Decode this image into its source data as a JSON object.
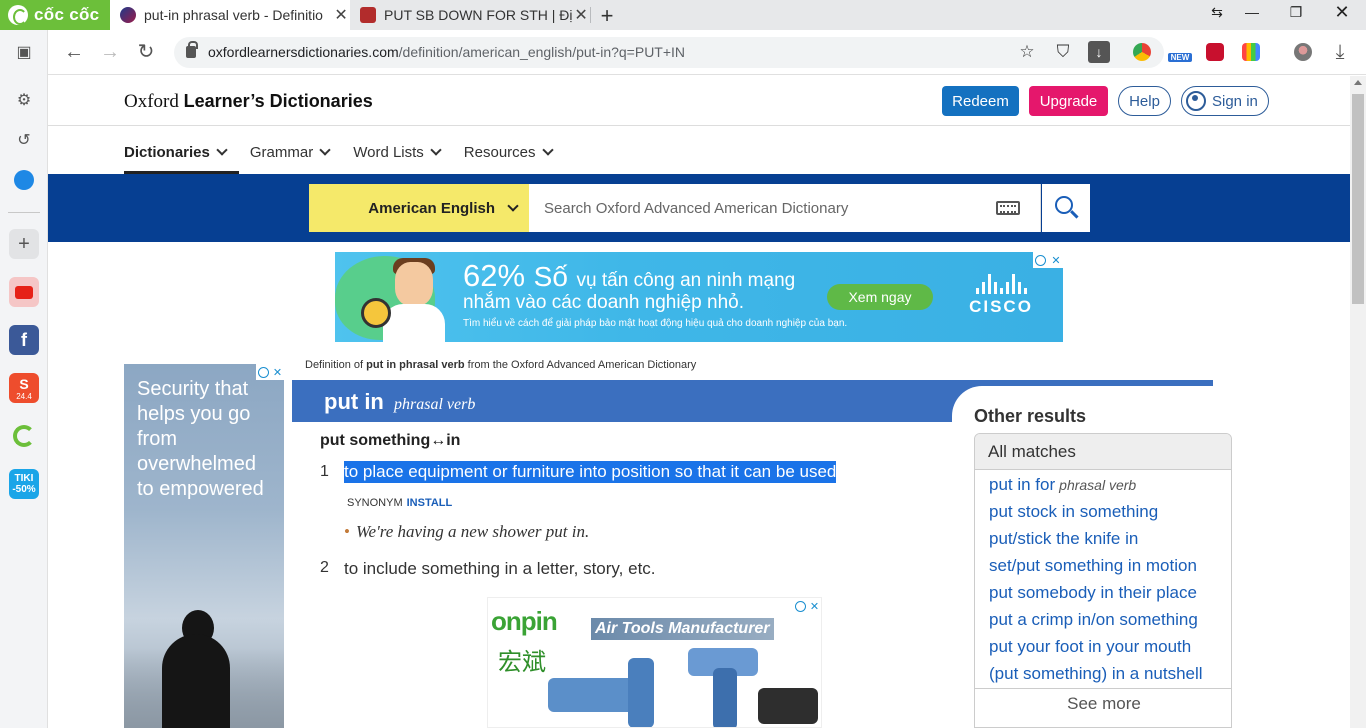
{
  "browser": {
    "brand": "cốc cốc",
    "tabs": [
      {
        "title": "put-in phrasal verb - Definitio",
        "active": true
      },
      {
        "title": "PUT SB DOWN FOR STH | Địn",
        "active": false
      }
    ],
    "url_host": "oxfordlearnersdictionaries.com",
    "url_path": "/definition/american_english/put-in?q=PUT+IN"
  },
  "sidebar": {
    "icons": [
      "panel-icon",
      "settings-icon",
      "history-icon",
      "messenger-icon",
      "add-icon",
      "youtube-icon",
      "facebook-icon",
      "shopee-icon",
      "coccoc-green-icon",
      "tiki-icon"
    ],
    "tiki_label": "TIKI -50%",
    "shopee_label": "24.4"
  },
  "header": {
    "logo_prefix": "Oxford",
    "logo_bold": "Learner’s Dictionaries",
    "redeem": "Redeem",
    "upgrade": "Upgrade",
    "help": "Help",
    "signin": "Sign in"
  },
  "nav": {
    "items": [
      "Dictionaries",
      "Grammar",
      "Word Lists",
      "Resources"
    ]
  },
  "search": {
    "dictionary": "American English",
    "placeholder": "Search Oxford Advanced American Dictionary"
  },
  "ad_top": {
    "big_pct": "62%",
    "big_word": "Số",
    "line1_rest": "vụ tấn công an ninh mạng",
    "line2": "nhắm vào các doanh nghiệp nhỏ.",
    "line3": "Tìm hiểu về cách để giải pháp bảo mật hoạt động hiệu quả cho doanh nghiệp của bạn.",
    "cta": "Xem ngay",
    "brand": "CISCO"
  },
  "ad_left": {
    "text": "Security that helps you go from overwhelmed to empowered"
  },
  "entry": {
    "note_prefix": "Definition of",
    "note_term": "put in phrasal verb",
    "note_suffix": "from the Oxford Advanced American Dictionary",
    "headword": "put in",
    "pos": "phrasal verb",
    "pattern": "put something↔in",
    "senses": [
      {
        "num": "1",
        "def": "to place equipment or furniture into position so that it can be used",
        "synonym_label": "SYNONYM",
        "synonym": "INSTALL",
        "example": "We're having a new shower put in."
      },
      {
        "num": "2",
        "def": "to include something in a letter, story, etc."
      }
    ]
  },
  "ad_mid": {
    "brand": "onpin",
    "cn": "宏斌",
    "tagline": "Air Tools Manufacturer"
  },
  "other_results": {
    "title": "Other results",
    "tab": "All matches",
    "items": [
      {
        "text": "put in for",
        "pos": "phrasal verb"
      },
      {
        "text": "put stock in something",
        "pos": ""
      },
      {
        "text": "put/stick the knife in",
        "pos": ""
      },
      {
        "text": "set/put something in motion",
        "pos": ""
      },
      {
        "text": "put somebody in their place",
        "pos": ""
      },
      {
        "text": "put a crimp in/on something",
        "pos": ""
      },
      {
        "text": "put your foot in your mouth",
        "pos": ""
      },
      {
        "text": "(put something) in a nutshell",
        "pos": ""
      }
    ],
    "see_more": "See more"
  }
}
